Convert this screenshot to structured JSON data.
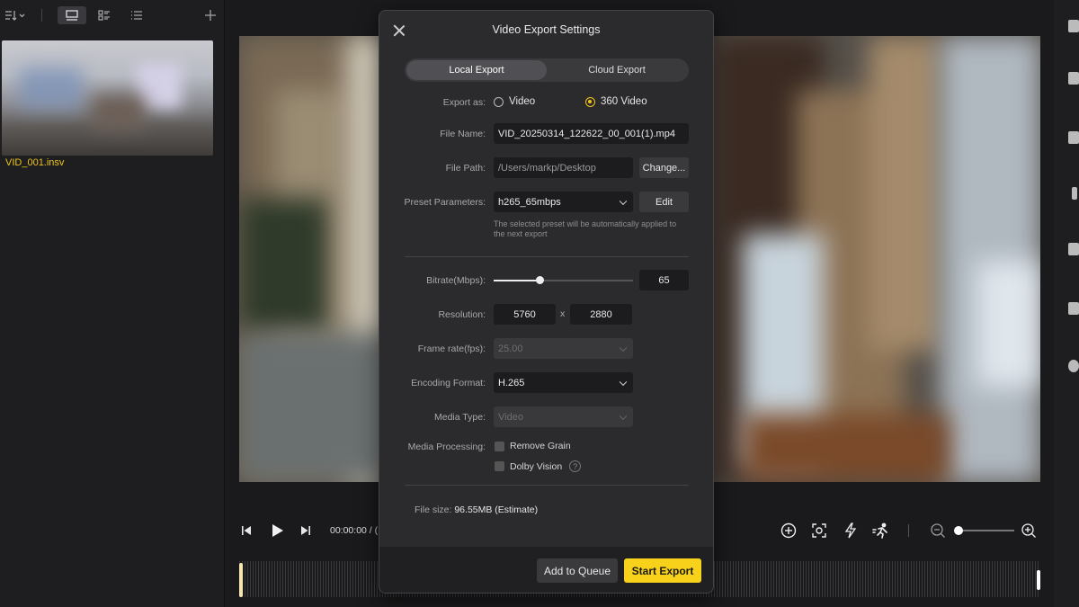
{
  "media": {
    "clip_name": "VID_001.insv"
  },
  "player": {
    "timecode": "00:00:00 / ("
  },
  "dialog": {
    "title": "Video Export Settings",
    "tabs": [
      {
        "label": "Local Export",
        "active": true
      },
      {
        "label": "Cloud Export",
        "active": false
      }
    ],
    "export_as": {
      "label": "Export as:",
      "options": [
        {
          "label": "Video",
          "selected": false
        },
        {
          "label": "360 Video",
          "selected": true
        }
      ]
    },
    "file_name": {
      "label": "File Name:",
      "value": "VID_20250314_122622_00_001(1).mp4"
    },
    "file_path": {
      "label": "File Path:",
      "value": "/Users/markp/Desktop",
      "button": "Change..."
    },
    "preset": {
      "label": "Preset Parameters:",
      "value": "h265_65mbps",
      "button": "Edit",
      "hint": "The selected preset will be automatically applied to the next export"
    },
    "bitrate": {
      "label": "Bitrate(Mbps):",
      "value": "65",
      "level": 0.33
    },
    "resolution": {
      "label": "Resolution:",
      "width": "5760",
      "separator": "x",
      "height": "2880"
    },
    "frame_rate": {
      "label": "Frame rate(fps):",
      "value": "25.00",
      "disabled": true
    },
    "encoding": {
      "label": "Encoding Format:",
      "value": "H.265"
    },
    "media_type": {
      "label": "Media Type:",
      "value": "Video",
      "disabled": true
    },
    "media_processing": {
      "label": "Media Processing:",
      "options": [
        {
          "label": "Remove Grain",
          "checked": false
        },
        {
          "label": "Dolby Vision",
          "checked": false,
          "help": "?"
        }
      ]
    },
    "file_size": {
      "label": "File size:",
      "value": "96.55MB (Estimate)"
    },
    "footer": {
      "add_to_queue": "Add to Queue",
      "start_export": "Start Export"
    }
  },
  "colors": {
    "accent": "#f8d21a",
    "clip_name": "#f0c419",
    "dialog_bg": "#2b2b2d"
  }
}
